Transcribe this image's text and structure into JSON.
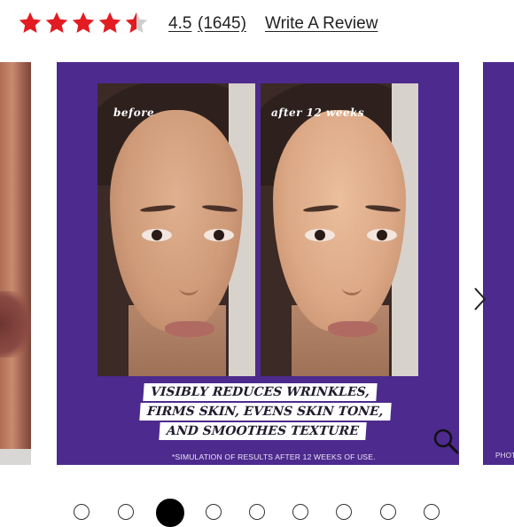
{
  "rating": {
    "stars": 4.5,
    "star_color": "#e21c22",
    "value": "4.5",
    "count": "(1645)",
    "write_review_label": "Write A Review"
  },
  "carousel": {
    "active_index": 3,
    "total_slides": 9,
    "main_slide": {
      "background": "#4d2a8e",
      "before_label": "before",
      "after_label": "after 12 weeks",
      "headline": [
        "VISIBLY REDUCES WRINKLES,",
        "FIRMS SKIN, EVENS SKIN TONE,",
        "AND SMOOTHES TEXTURE"
      ],
      "disclaimer": "*SIMULATION OF RESULTS AFTER 12 WEEKS OF USE."
    },
    "next_slide_caption": "PHOT",
    "icons": {
      "prev": "chevron-left-icon",
      "next": "chevron-right-icon",
      "zoom": "magnifier-icon"
    }
  }
}
